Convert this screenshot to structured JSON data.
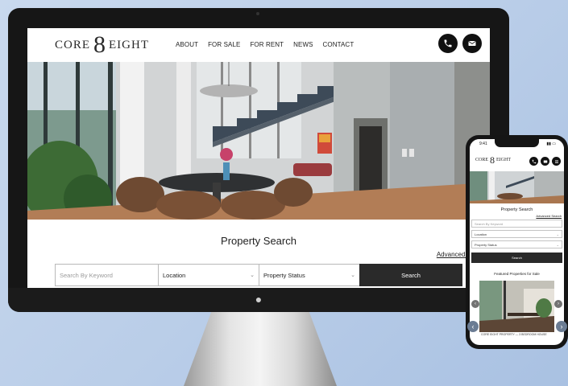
{
  "desktop": {
    "logo": {
      "word1": "CORE",
      "numeral": "8",
      "word2": "EIGHT"
    },
    "nav": [
      {
        "label": "ABOUT"
      },
      {
        "label": "FOR SALE"
      },
      {
        "label": "FOR RENT"
      },
      {
        "label": "NEWS"
      },
      {
        "label": "CONTACT"
      }
    ],
    "icons": [
      "phone-icon",
      "envelope-icon"
    ],
    "search": {
      "title": "Property Search",
      "advanced_link": "Advanced Search",
      "keyword_placeholder": "Search By Keyword",
      "location_value": "Location",
      "status_value": "Property Status",
      "button_label": "Search"
    }
  },
  "phone": {
    "time": "9:41",
    "logo": {
      "word1": "CORE",
      "numeral": "8",
      "word2": "EIGHT"
    },
    "search": {
      "title": "Property Search",
      "advanced_link": "Advanced Search",
      "keyword_placeholder": "Search By Keyword",
      "location_value": "Location",
      "status_value": "Property Status",
      "button_label": "Search"
    },
    "featured_title": "Featured Properties for Sale",
    "card_caption": "CORE EIGHT PROPERTY — 3 BEDROOM HOUSE"
  },
  "colors": {
    "brand_dark": "#111111",
    "button": "#2a2a2a",
    "background": "#c3d5ec"
  }
}
